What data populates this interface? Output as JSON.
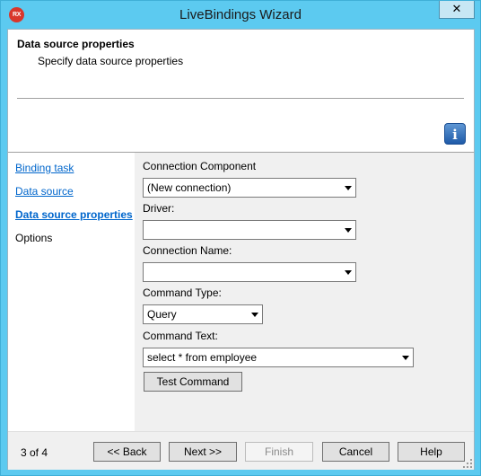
{
  "window": {
    "title": "LiveBindings Wizard",
    "app_icon_text": "RX",
    "close_glyph": "✕"
  },
  "header": {
    "title": "Data source properties",
    "subtitle": "Specify data source properties",
    "info_icon": "info-icon"
  },
  "nav": {
    "items": [
      {
        "label": "Binding task"
      },
      {
        "label": "Data source"
      },
      {
        "label": "Data source properties"
      },
      {
        "label": "Options"
      }
    ]
  },
  "form": {
    "connection_component": {
      "label": "Connection Component",
      "value": "(New connection)"
    },
    "driver": {
      "label": "Driver:",
      "value": ""
    },
    "connection_name": {
      "label": "Connection Name:",
      "value": ""
    },
    "command_type": {
      "label": "Command Type:",
      "value": "Query"
    },
    "command_text": {
      "label": "Command Text:",
      "value": "select * from employee"
    },
    "test_command_label": "Test Command"
  },
  "footer": {
    "page_counter": "3 of 4",
    "back_label": "<< Back",
    "next_label": "Next >>",
    "finish_label": "Finish",
    "cancel_label": "Cancel",
    "help_label": "Help"
  },
  "colors": {
    "title_bar": "#5ccaf0",
    "link": "#0066cc",
    "panel_bg": "#f0f0f0",
    "app_icon": "#d9362b"
  }
}
